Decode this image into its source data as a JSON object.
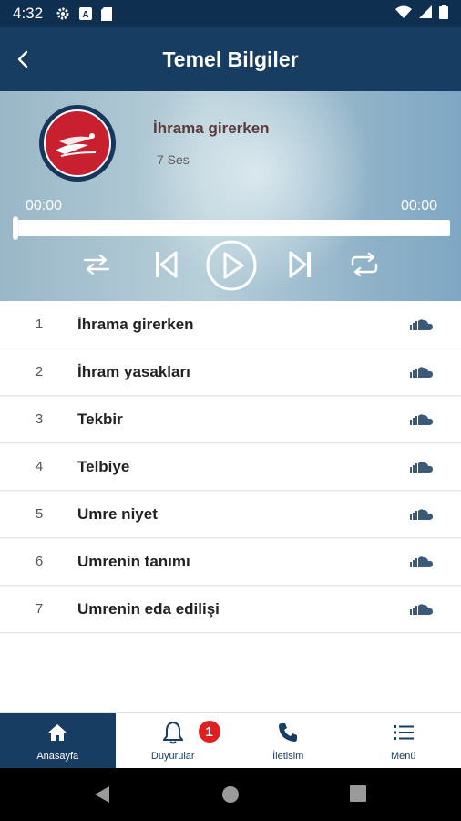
{
  "status_bar": {
    "time": "4:32",
    "icons_left": [
      "gear-icon",
      "a-icon",
      "sd-card-icon"
    ],
    "icons_right": [
      "wifi-icon",
      "signal-icon",
      "battery-icon"
    ]
  },
  "app_bar": {
    "title": "Temel Bilgiler",
    "back_icon": "chevron-left-icon"
  },
  "player": {
    "track_title": "İhrama girerken",
    "track_count": "7 Ses",
    "time_elapsed": "00:00",
    "time_total": "00:00",
    "progress": 0,
    "controls": [
      "shuffle-icon",
      "previous-icon",
      "play-icon",
      "next-icon",
      "repeat-icon"
    ]
  },
  "tracks": [
    {
      "number": "1",
      "title": "İhrama girerken"
    },
    {
      "number": "2",
      "title": "İhram yasakları"
    },
    {
      "number": "3",
      "title": "Tekbir"
    },
    {
      "number": "4",
      "title": "Telbiye"
    },
    {
      "number": "5",
      "title": "Umre niyet"
    },
    {
      "number": "6",
      "title": "Umrenin tanımı"
    },
    {
      "number": "7",
      "title": "Umrenin eda edilişi"
    }
  ],
  "bottom_nav": {
    "items": [
      {
        "label": "Anasayfa",
        "icon": "home-icon",
        "active": true
      },
      {
        "label": "Duyurular",
        "icon": "bell-icon",
        "badge": "1"
      },
      {
        "label": "İletisim",
        "icon": "phone-icon"
      },
      {
        "label": "Menü",
        "icon": "list-icon"
      }
    ]
  },
  "colors": {
    "primary": "#173d63",
    "status_bar": "#0f2f50",
    "logo_red": "#c8202e",
    "badge_red": "#e02020"
  }
}
